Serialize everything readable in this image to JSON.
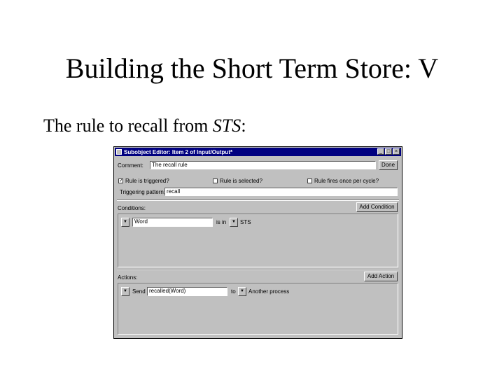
{
  "slide": {
    "title": "Building the Short Term Store: V",
    "text_prefix": "The rule to recall from ",
    "text_emph": "STS",
    "text_suffix": ":"
  },
  "window": {
    "title": "Subobject Editor: Item 2 of Input/Output*",
    "controls": {
      "minimize": "_",
      "maximize": "□",
      "close": "×"
    },
    "comment": {
      "label": "Comment:",
      "value": "The recall rule",
      "done_button": "Done"
    },
    "options": {
      "triggered": {
        "label": "Rule is triggered?",
        "checked": true,
        "mark": "✓"
      },
      "selected": {
        "label": "Rule is selected?",
        "checked": false,
        "mark": ""
      },
      "once": {
        "label": "Rule fires once per cycle?",
        "checked": false,
        "mark": ""
      }
    },
    "trigger_pattern": {
      "label": "Triggering pattern:",
      "value": "recall"
    },
    "conditions": {
      "label": "Conditions:",
      "add_button": "Add Condition",
      "rows": [
        {
          "dropdown_glyph": "▼",
          "value": "Word",
          "relation": "is in",
          "relation_glyph": "▼",
          "target": "STS"
        }
      ]
    },
    "actions": {
      "label": "Actions:",
      "add_button": "Add Action",
      "rows": [
        {
          "dropdown_glyph": "▼",
          "verb": "Send",
          "value": "recalled(Word)",
          "preposition": "to",
          "target_glyph": "▼",
          "target": "Another process"
        }
      ]
    }
  }
}
